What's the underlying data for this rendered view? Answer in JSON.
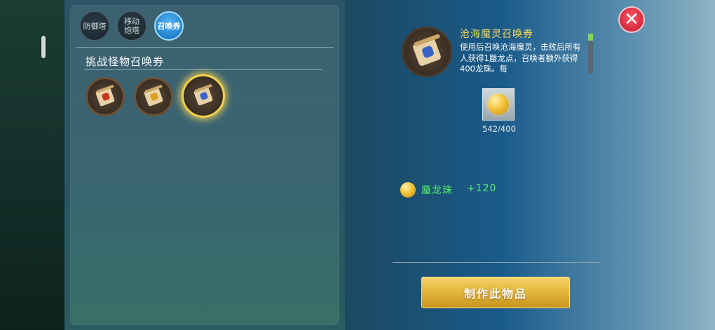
{
  "tabs": [
    {
      "label": "防御塔",
      "active": false
    },
    {
      "label": "移动炮塔",
      "active": false
    },
    {
      "label": "召唤券",
      "active": true
    }
  ],
  "section": {
    "title": "挑战怪物召唤券"
  },
  "items": [
    {
      "icon": "summon-scroll-red-icon",
      "selected": false
    },
    {
      "icon": "summon-scroll-gold-icon",
      "selected": false
    },
    {
      "icon": "summon-scroll-blue-icon",
      "selected": true
    }
  ],
  "detail": {
    "title": "沧海魔灵召唤券",
    "description": "使用后召唤沧海魔灵，击败后所有人获得1蜃龙点，召唤者额外获得400龙珠。每"
  },
  "ingredient": {
    "icon": "dragon-pearl-icon",
    "count": "542/400"
  },
  "reward": {
    "icon": "dragon-pearl-icon",
    "name": "蜃龙珠",
    "amount": "+120"
  },
  "craft_button": {
    "label": "制作此物品"
  },
  "colors": {
    "title": "#f6d95a",
    "reward": "#56f06a",
    "tab_active": "#2b8fdc",
    "button": "#e0b43a"
  }
}
